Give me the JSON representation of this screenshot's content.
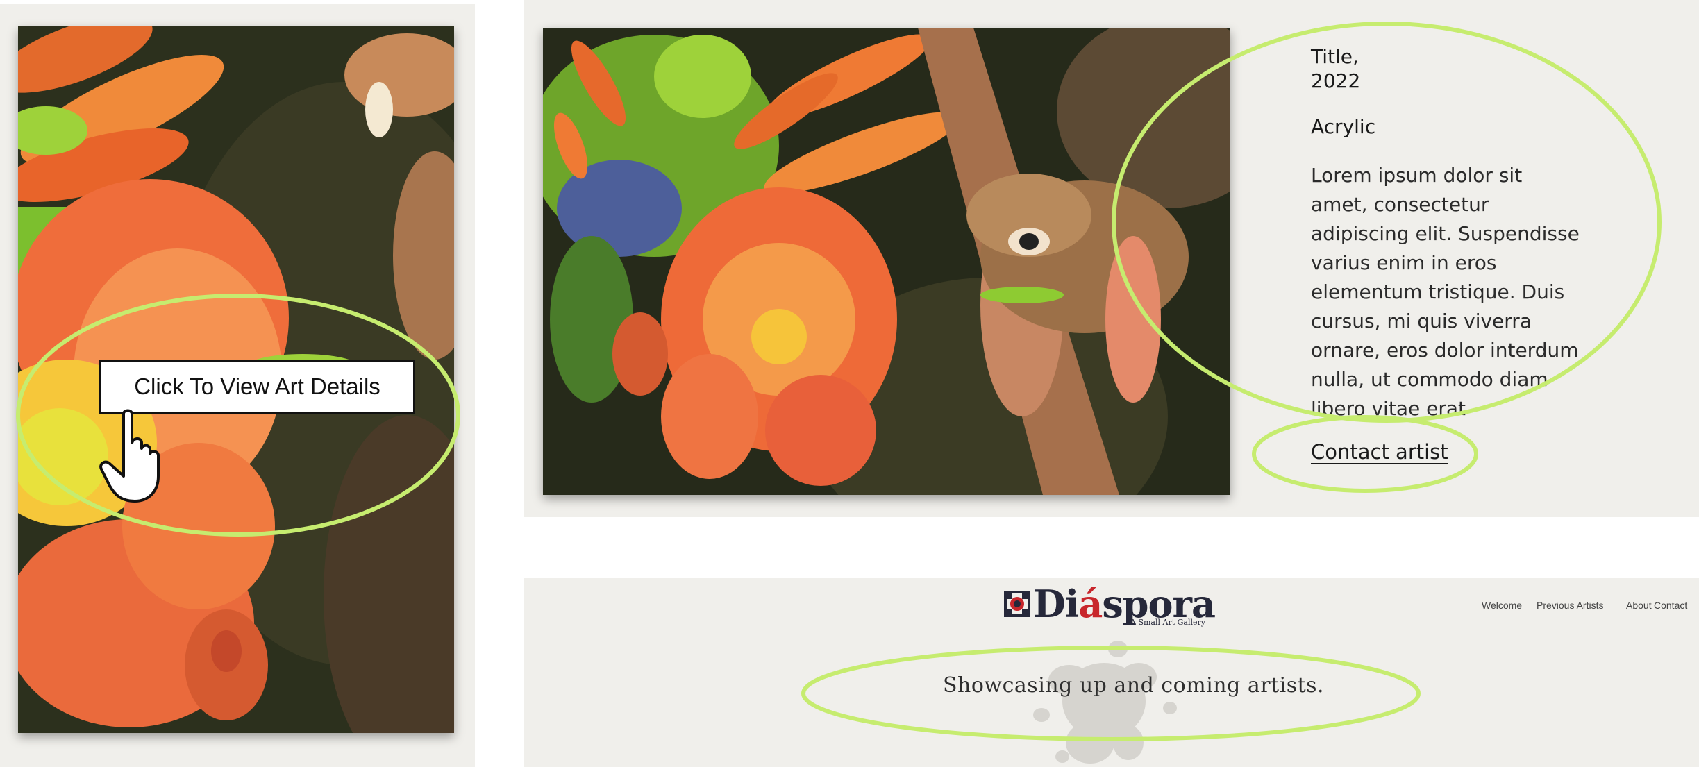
{
  "left_card": {
    "callout_label": "Click To View Art Details"
  },
  "details": {
    "title": "Title,\n2022",
    "medium": "Acrylic",
    "description": "Lorem ipsum dolor sit\namet, consectetur\nadipiscing elit. Suspendisse\nvarius enim in eros\nelementum tristique. Duis\ncursus, mi quis viverra\nornare, eros dolor interdum\nnulla, ut commodo diam\nlibero vitae erat",
    "contact_label": "Contact artist"
  },
  "site": {
    "logo_prefix": "Di",
    "logo_accent": "á",
    "logo_suffix": "spora",
    "logo_subtitle": "A Small Art Gallery",
    "nav": [
      "Welcome",
      "Previous Artists",
      "About",
      "Contact"
    ],
    "tagline": "Showcasing up and coming artists."
  },
  "colors": {
    "panel_bg": "#f0efeb",
    "highlight_ellipse": "#c6ec6f",
    "logo_navy": "#26283a",
    "logo_red": "#c8262b",
    "painting_dark": "#2a2e1d",
    "flower_orange": "#f0743a",
    "leaf_green": "#9ed23a"
  },
  "icons": {
    "pointer": "hand-pointer-icon",
    "logo_mark": "diaspora-emblem-icon",
    "splash": "ink-splash-icon"
  }
}
